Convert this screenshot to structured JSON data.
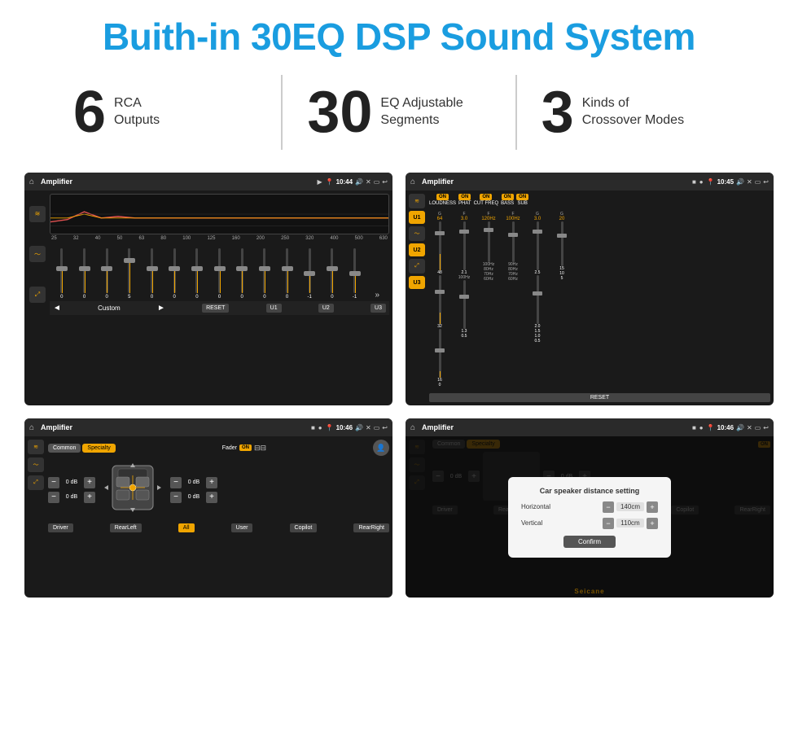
{
  "header": {
    "title": "Buith-in 30EQ DSP Sound System"
  },
  "stats": [
    {
      "number": "6",
      "line1": "RCA",
      "line2": "Outputs"
    },
    {
      "number": "30",
      "line1": "EQ Adjustable",
      "line2": "Segments"
    },
    {
      "number": "3",
      "line1": "Kinds of",
      "line2": "Crossover Modes"
    }
  ],
  "screens": {
    "eq": {
      "title": "Amplifier",
      "time": "10:44",
      "labels": [
        "25",
        "32",
        "40",
        "50",
        "63",
        "80",
        "100",
        "125",
        "160",
        "200",
        "250",
        "320",
        "400",
        "500",
        "630"
      ],
      "values": [
        "0",
        "0",
        "0",
        "5",
        "0",
        "0",
        "0",
        "0",
        "0",
        "0",
        "0",
        "-1",
        "0",
        "-1"
      ],
      "mode": "Custom",
      "buttons": [
        "RESET",
        "U1",
        "U2",
        "U3"
      ]
    },
    "amp": {
      "title": "Amplifier",
      "time": "10:45",
      "presets": [
        "U1",
        "U2",
        "U3"
      ],
      "toggles": [
        "LOUDNESS",
        "PHAT",
        "CUT FREQ",
        "BASS",
        "SUB"
      ],
      "reset": "RESET"
    },
    "fader": {
      "title": "Amplifier",
      "time": "10:46",
      "tabs": [
        "Common",
        "Specialty"
      ],
      "activeTab": "Specialty",
      "faderLabel": "Fader",
      "channels": {
        "fl": "0 dB",
        "fr": "0 dB",
        "rl": "0 dB",
        "rr": "0 dB"
      },
      "buttons": {
        "driver": "Driver",
        "rearLeft": "RearLeft",
        "all": "All",
        "user": "User",
        "copilot": "Copilot",
        "rearRight": "RearRight"
      }
    },
    "dialog": {
      "title": "Amplifier",
      "time": "10:46",
      "tabs": [
        "Common",
        "Specialty"
      ],
      "dialogTitle": "Car speaker distance setting",
      "horizontal": {
        "label": "Horizontal",
        "value": "140cm"
      },
      "vertical": {
        "label": "Vertical",
        "value": "110cm"
      },
      "confirmBtn": "Confirm",
      "buttons": {
        "driver": "Driver",
        "rearLeft": "RearLeft",
        "user": "User",
        "copilot": "Copilot",
        "rearRight": "RearRight"
      }
    }
  },
  "watermark": "Seicane"
}
